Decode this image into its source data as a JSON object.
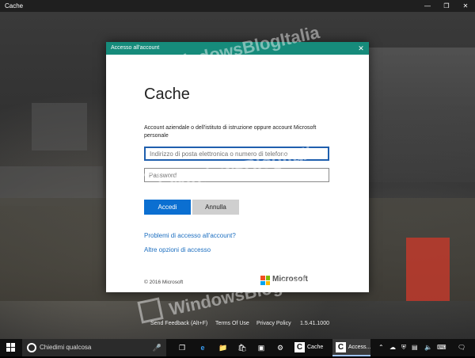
{
  "window": {
    "title": "Cache",
    "minimize_icon": "minimize-icon",
    "maximize_icon": "maximize-icon",
    "close_icon": "close-icon"
  },
  "dialog": {
    "title": "Accesso all'account",
    "app_name": "Cache",
    "description": "Account aziendale o dell'istituto di istruzione oppure account Microsoft personale",
    "email_placeholder": "Indirizzo di posta elettronica o numero di telefono",
    "password_placeholder": "Password",
    "signin_label": "Accedi",
    "cancel_label": "Annulla",
    "link_problems": "Problemi di accesso all'account?",
    "link_options": "Altre opzioni di accesso",
    "copyright": "© 2016 Microsoft",
    "brand": "Microsoft",
    "accent_color": "#168b7b",
    "button_color": "#0b6fd1"
  },
  "watermark": {
    "text": "WindowsBlogItalia"
  },
  "app_footer": {
    "send_feedback": "Send Feedback (Alt+F)",
    "terms": "Terms Of Use",
    "privacy": "Privacy Policy",
    "version": "1.5.41.1000"
  },
  "taskbar": {
    "search_placeholder": "Chiedimi qualcosa",
    "apps": [
      {
        "label": "Cache",
        "icon": "C"
      },
      {
        "label": "Access...",
        "icon": "C"
      }
    ],
    "pinned_icons": [
      "task-view-icon",
      "edge-icon",
      "file-explorer-icon",
      "store-icon",
      "photos-icon",
      "settings-icon"
    ],
    "tray_icons": [
      "people-icon",
      "onedrive-icon",
      "defender-icon",
      "network-icon",
      "volume-icon",
      "keyboard-icon",
      "notification-icon"
    ]
  }
}
